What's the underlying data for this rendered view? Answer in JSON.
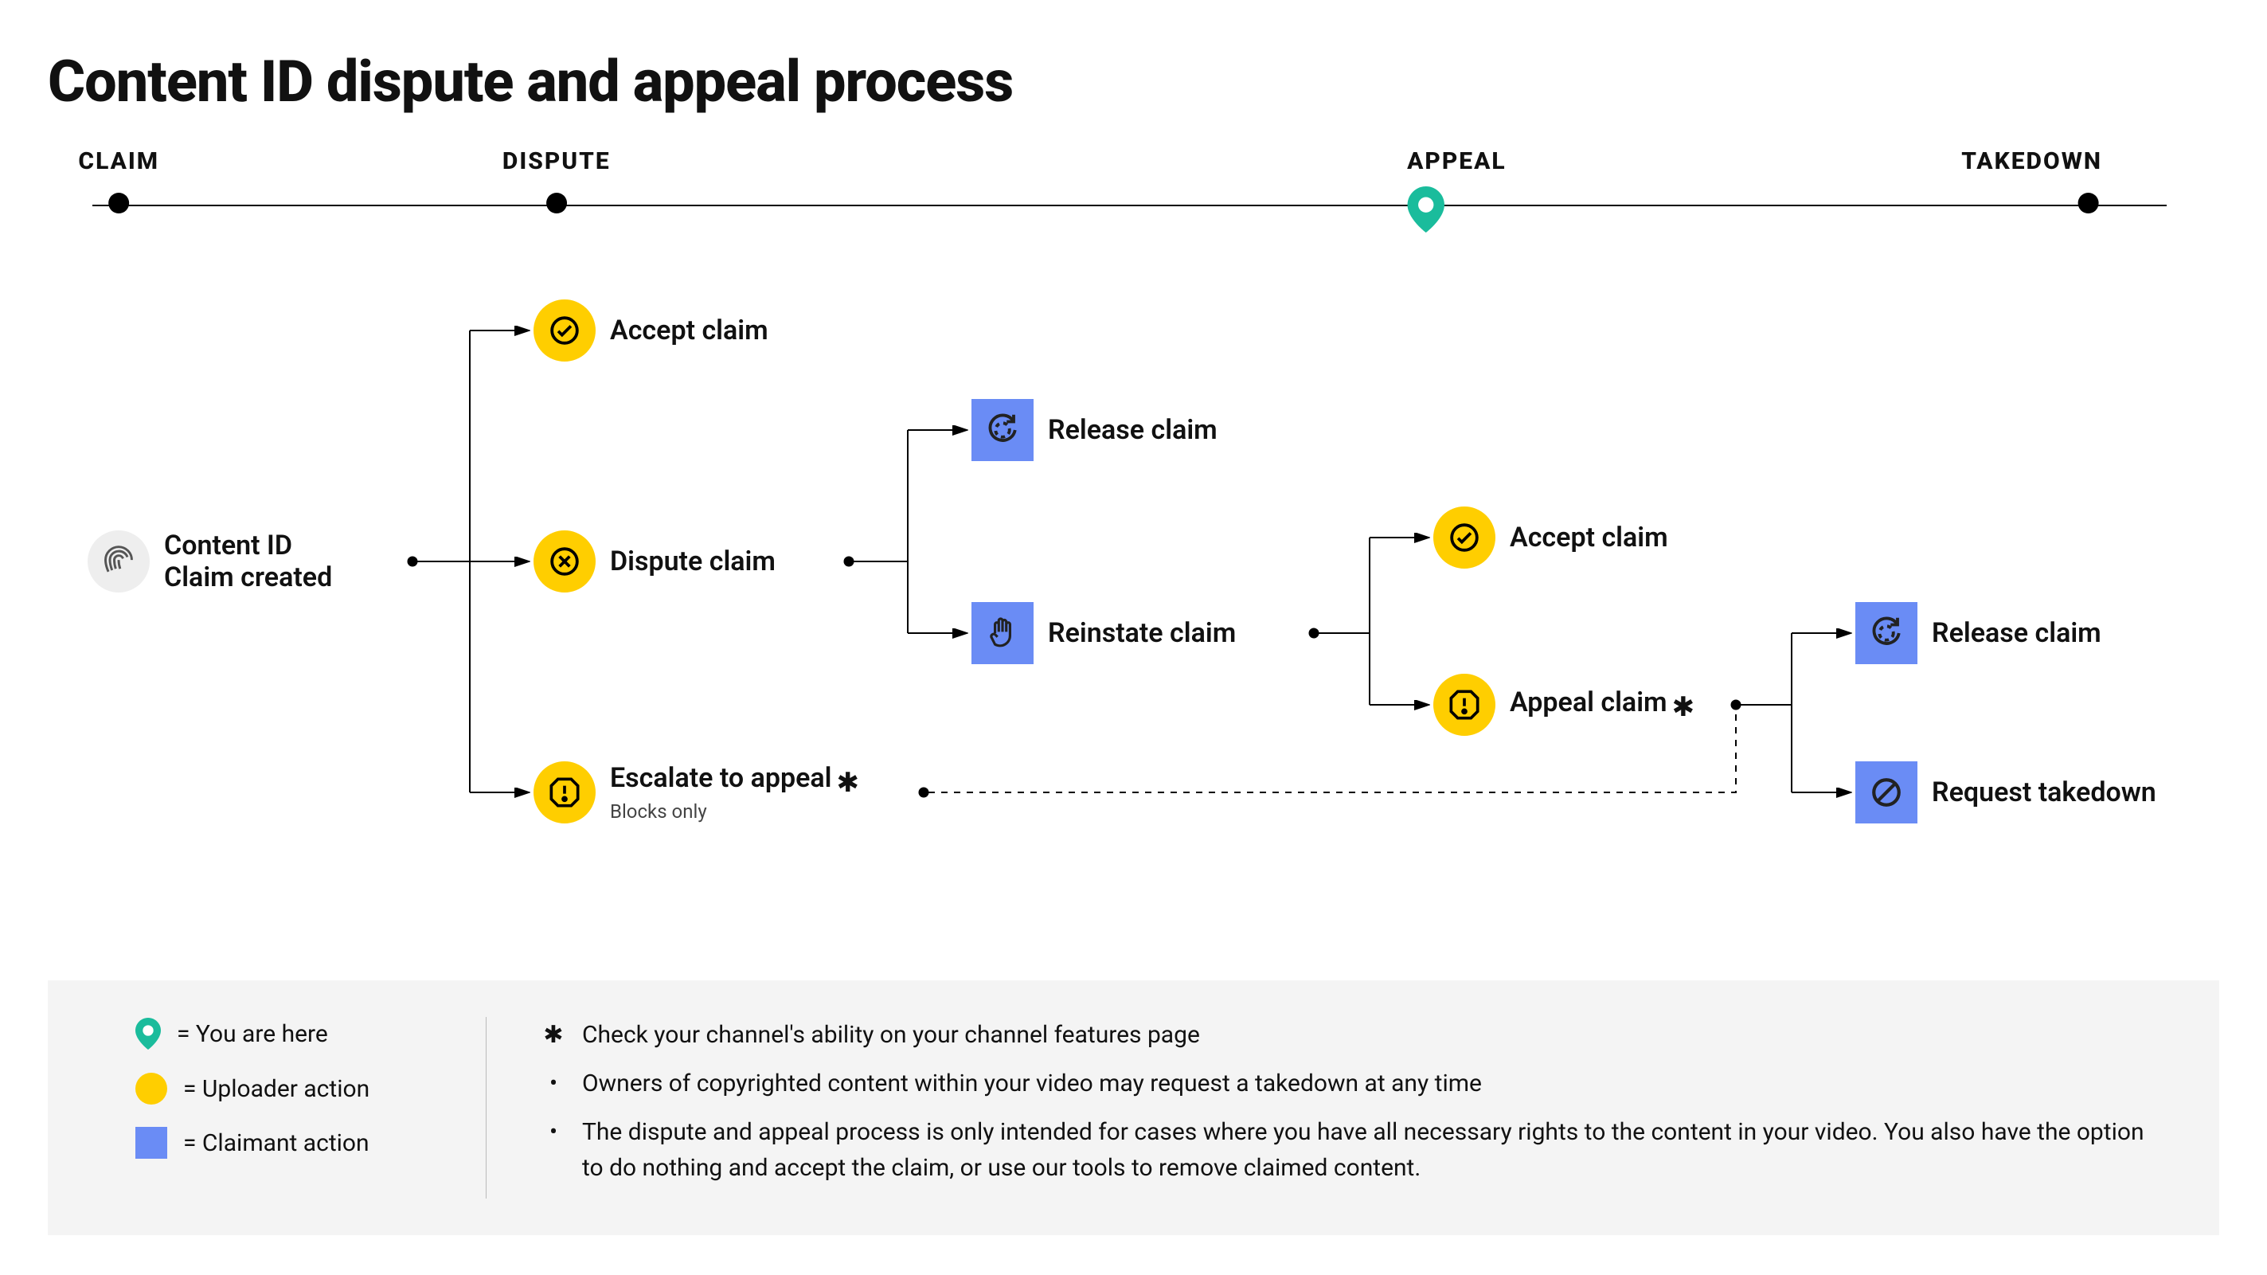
{
  "title": "Content ID dispute and appeal process",
  "stages": {
    "claim": "CLAIM",
    "dispute": "DISPUTE",
    "appeal": "APPEAL",
    "takedown": "TAKEDOWN"
  },
  "nodes": {
    "start": {
      "line1": "Content ID",
      "line2": "Claim created"
    },
    "accept1": "Accept claim",
    "dispute": "Dispute claim",
    "escalate": "Escalate to appeal",
    "escalate_sub": "Blocks only",
    "release1": "Release claim",
    "reinstate": "Reinstate claim",
    "accept2": "Accept claim",
    "appeal": "Appeal claim",
    "release2": "Release claim",
    "takedown": "Request takedown"
  },
  "legend": {
    "here": "= You are here",
    "uploader": "= Uploader action",
    "claimant": "= Claimant action",
    "note_star": "Check your channel's ability on your channel features page",
    "note1": "Owners of copyrighted content within your video may request a takedown at any time",
    "note2": "The dispute and appeal process is only intended for cases where you have all necessary rights to the content in your video. You also have the option to do nothing and accept the claim, or use our tools to remove claimed content."
  },
  "colors": {
    "teal": "#1abc9c",
    "yellow": "#ffce00",
    "blue": "#6a8cf5"
  }
}
